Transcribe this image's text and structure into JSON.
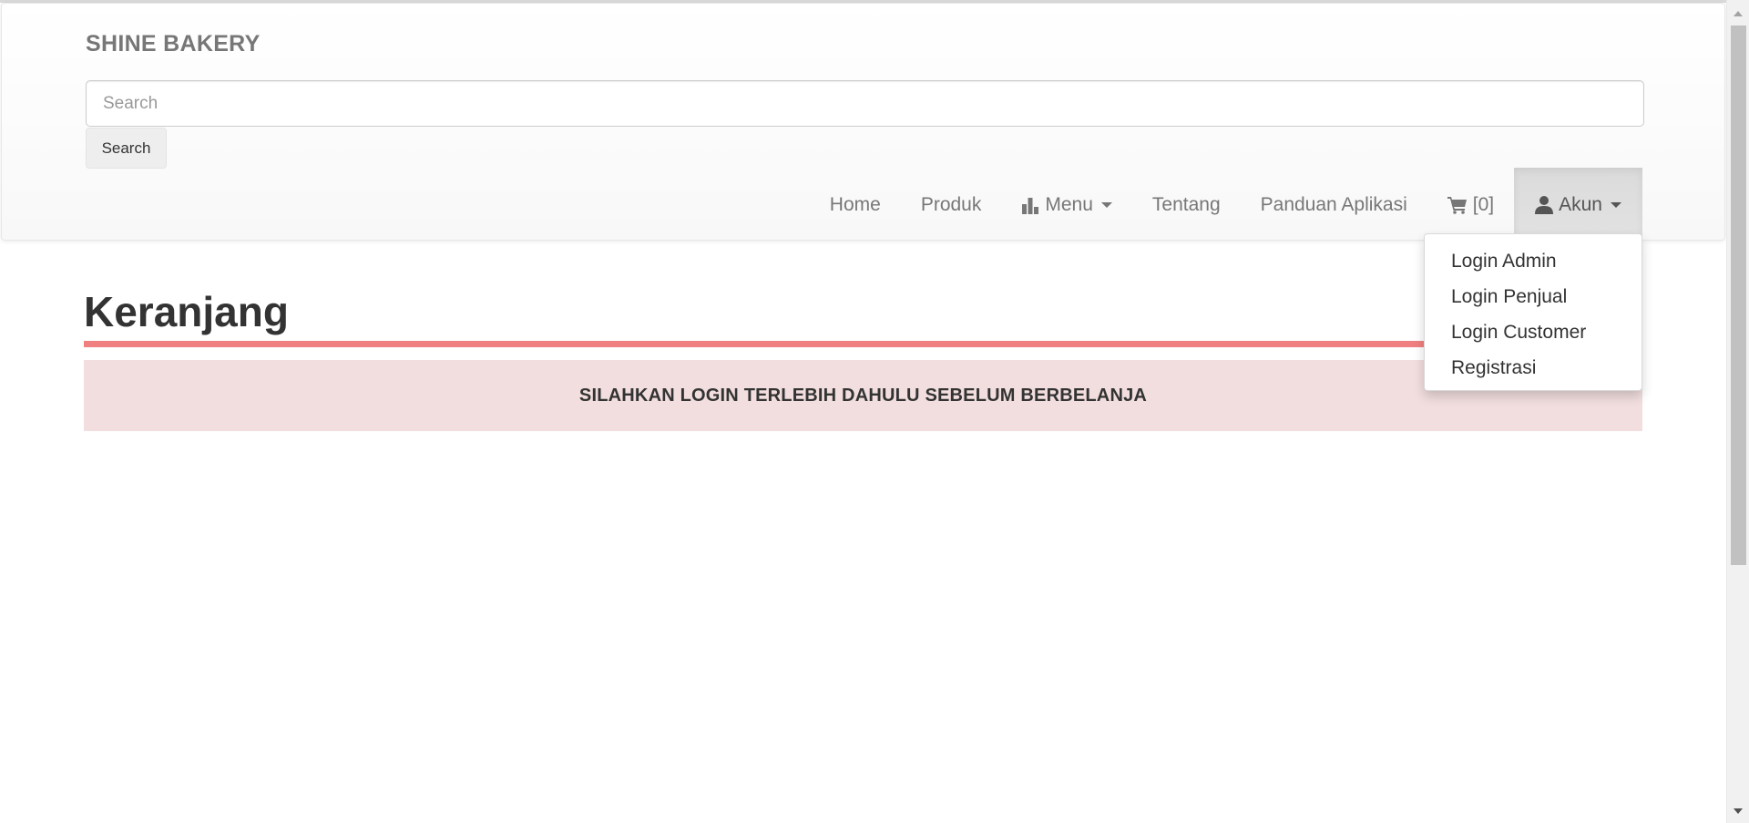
{
  "header": {
    "brand": "SHINE BAKERY",
    "search": {
      "placeholder": "Search",
      "value": "",
      "button_label": "Search"
    }
  },
  "nav": {
    "items": [
      {
        "label": "Home"
      },
      {
        "label": "Produk"
      },
      {
        "label": "Menu",
        "icon": "bar-chart-icon",
        "has_caret": true
      },
      {
        "label": "Tentang"
      },
      {
        "label": "Panduan Aplikasi"
      },
      {
        "label": "[0]",
        "icon": "shopping-cart-icon"
      },
      {
        "label": "Akun",
        "icon": "user-icon",
        "has_caret": true,
        "active": true
      }
    ]
  },
  "account_dropdown": {
    "items": [
      {
        "label": "Login Admin"
      },
      {
        "label": "Login Penjual"
      },
      {
        "label": "Login Customer"
      },
      {
        "label": "Registrasi"
      }
    ]
  },
  "main": {
    "title": "Keranjang",
    "alert": "SILAHKAN LOGIN TERLEBIH DAHULU SEBELUM BERBELANJA"
  },
  "colors": {
    "title_rule": "#f08080",
    "alert_background": "#f2dede",
    "brand_text": "#777777"
  }
}
